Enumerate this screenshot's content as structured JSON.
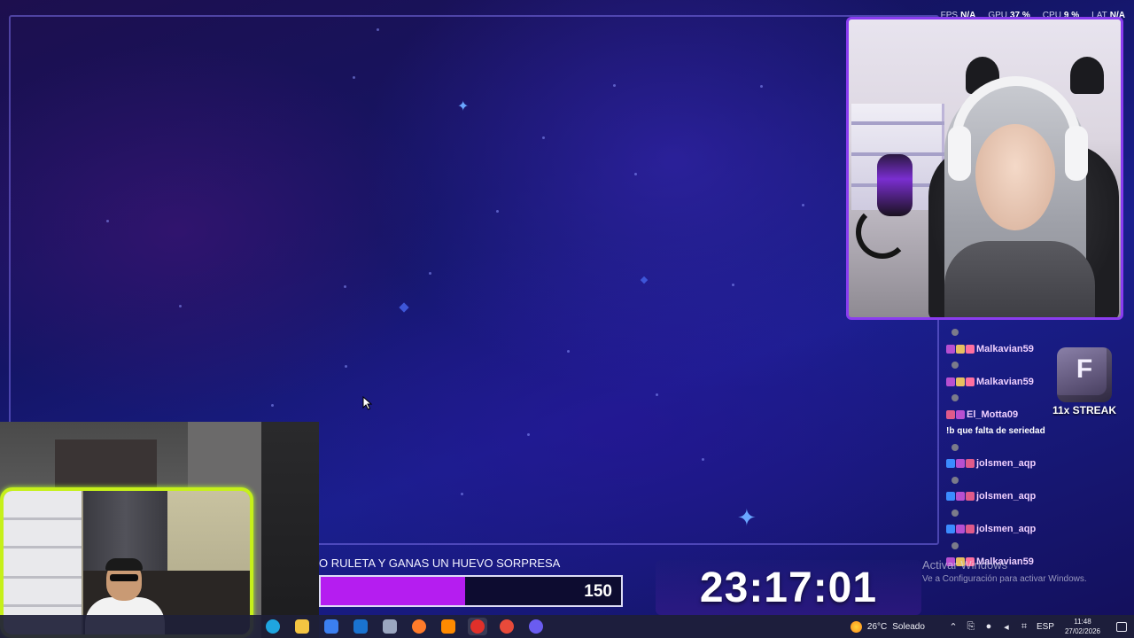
{
  "stats": [
    {
      "key": "FPS",
      "value": "N/A"
    },
    {
      "key": "GPU",
      "value": "37 %"
    },
    {
      "key": "CPU",
      "value": "9 %"
    },
    {
      "key": "LAT",
      "value": "N/A"
    }
  ],
  "chat": [
    {
      "type": "user",
      "name": "Malkavian59",
      "badges": [
        "#b84fd0",
        "#e8c060",
        "#ff70a0"
      ]
    },
    {
      "type": "user",
      "name": "Malkavian59",
      "badges": [
        "#b84fd0",
        "#e8c060",
        "#ff70a0"
      ]
    },
    {
      "type": "user",
      "name": "El_Motta09",
      "badges": [
        "#e05a8a",
        "#b84fd0"
      ]
    },
    {
      "type": "message",
      "text": "!b que falta de seriedad"
    },
    {
      "type": "user",
      "name": "jolsmen_aqp",
      "badges": [
        "#3b8cff",
        "#b84fd0",
        "#e05a8a"
      ]
    },
    {
      "type": "user",
      "name": "jolsmen_aqp",
      "badges": [
        "#3b8cff",
        "#b84fd0",
        "#e05a8a"
      ]
    },
    {
      "type": "user",
      "name": "jolsmen_aqp",
      "badges": [
        "#3b8cff",
        "#b84fd0",
        "#e05a8a"
      ]
    },
    {
      "type": "user",
      "name": "Malkavian59",
      "badges": [
        "#b84fd0",
        "#e8c060",
        "#ff70a0"
      ]
    }
  ],
  "streak": {
    "letter": "F",
    "label": "11x STREAK"
  },
  "goal": {
    "text": "O RULETA Y GANAS UN HUEVO SORPRESA",
    "value": "150",
    "fill_fraction": 0.48,
    "fill_color": "#b51df0"
  },
  "timer": {
    "value": "23:17:01"
  },
  "watermark": {
    "title": "Activar Windows",
    "subtitle": "Ve a Configuración para activar Windows."
  },
  "taskbar": {
    "apps": [
      {
        "name": "edge-icon",
        "color": "#1fa5e0",
        "active": false
      },
      {
        "name": "file-explorer-icon",
        "color": "#f4c542",
        "active": false
      },
      {
        "name": "store-icon",
        "color": "#3b7ff0",
        "active": false
      },
      {
        "name": "outlook-icon",
        "color": "#1a73d0",
        "active": false
      },
      {
        "name": "photos-icon",
        "color": "#9aa6c0",
        "active": false
      },
      {
        "name": "firefox-icon",
        "color": "#ff7b2a",
        "active": false
      },
      {
        "name": "vlc-icon",
        "color": "#ff8a00",
        "active": false
      },
      {
        "name": "obs-record-icon",
        "color": "#e0302a",
        "active": true
      },
      {
        "name": "chrome-icon",
        "color": "#e84a3a",
        "active": false
      },
      {
        "name": "discord-icon",
        "color": "#6a5cf0",
        "active": false
      }
    ],
    "weather": {
      "temp": "26°C",
      "condition": "Soleado"
    },
    "language": "ESP",
    "time": "11:48",
    "date": "27/02/2026"
  }
}
